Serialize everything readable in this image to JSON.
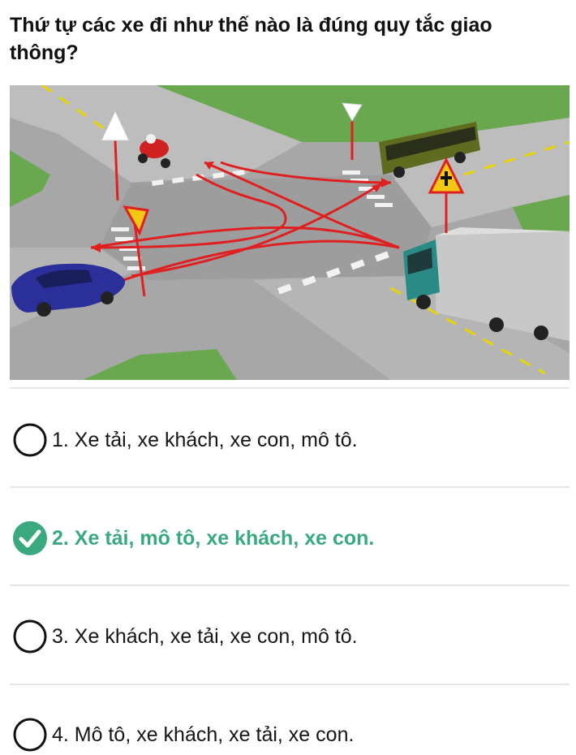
{
  "question": {
    "text": "Thứ tự các xe đi như thế nào là đúng quy tắc giao thông?"
  },
  "scene": {
    "image_name": "intersection-illustration",
    "colors": {
      "road": "#a9a9a9",
      "grass": "#6aa84f",
      "route": "#e02020",
      "bus": "#5f6b1f",
      "car": "#2a2f9a",
      "truck_cab": "#2a8a86",
      "truck_box": "#c8c8c8",
      "motorbike": "#d02020"
    },
    "icons": [
      "bus-icon",
      "truck-icon",
      "car-icon",
      "motorbike-icon",
      "yield-sign-icon",
      "priority-road-sign-icon"
    ]
  },
  "options": [
    {
      "number": "1.",
      "label": "1. Xe tải, xe khách, xe con, mô tô.",
      "state": "unselected"
    },
    {
      "number": "2.",
      "label": "2. Xe tải, mô tô, xe khách, xe con.",
      "state": "correct"
    },
    {
      "number": "3.",
      "label": "3. Xe khách, xe tải, xe con, mô tô.",
      "state": "unselected"
    },
    {
      "number": "4.",
      "label": "4. Mô tô, xe khách, xe tải, xe con.",
      "state": "unselected"
    }
  ],
  "theme": {
    "correct_color": "#3aa97f",
    "radio_stroke": "#111111",
    "divider": "#e6e6e6"
  }
}
